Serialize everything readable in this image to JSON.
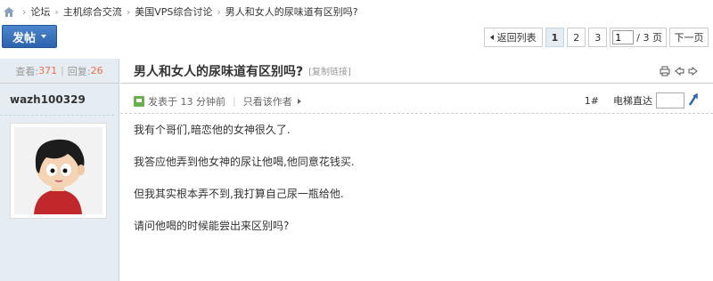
{
  "breadcrumb": {
    "items": [
      "论坛",
      "主机综合交流",
      "美国VPS综合讨论",
      "男人和女人的尿味道有区别吗?"
    ]
  },
  "toolbar": {
    "post_label": "发帖",
    "back_label": "返回列表",
    "pages": [
      "1",
      "2",
      "3"
    ],
    "current_page": "1",
    "page_input_value": "1",
    "page_total": "/ 3 页",
    "next_label": "下一页"
  },
  "sidebar": {
    "views_label": "查看:",
    "views_count": "371",
    "replies_label": "回复:",
    "replies_count": "26",
    "author": "wazh100329"
  },
  "post": {
    "title": "男人和女人的尿味道有区别吗?",
    "copy_link": "[复制链接]",
    "posted": "发表于 13 分钟前",
    "only_author": "只看该作者",
    "floor": "1#",
    "jump_label": "电梯直达",
    "body": [
      "我有个哥们,暗恋他的女神很久了.",
      "我答应他弄到他女神的尿让他喝,他同意花钱买.",
      "但我其实根本弄不到,我打算自己尿一瓶给他.",
      "请问他喝的时候能尝出来区别吗?"
    ]
  },
  "colors": {
    "accent_blue": "#2c63ad",
    "side_bg": "#e5edf2",
    "count_orange": "#f26c4f"
  },
  "icons": [
    "home-icon",
    "caret-down-icon",
    "back-arrow-icon",
    "print-icon",
    "prev-thread-icon",
    "next-thread-icon",
    "post-time-icon",
    "jump-arrow-icon"
  ]
}
